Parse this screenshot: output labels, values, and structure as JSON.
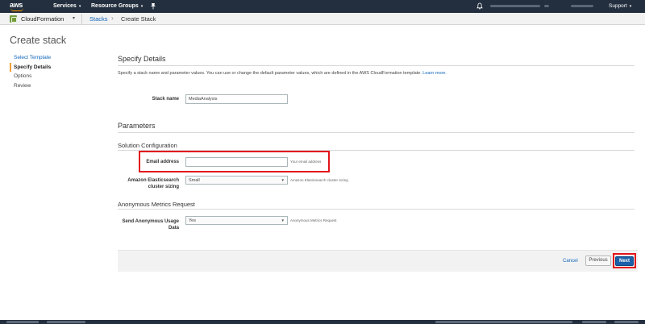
{
  "topnav": {
    "logo_text": "aws",
    "services_label": "Services",
    "resource_groups_label": "Resource Groups",
    "pin_icon": "pin-icon",
    "bell_icon": "bell-icon",
    "support_label": "Support"
  },
  "subnav": {
    "service_label": "CloudFormation",
    "breadcrumb": {
      "stacks_label": "Stacks",
      "separator": "›",
      "current": "Create Stack"
    }
  },
  "page": {
    "title": "Create stack",
    "steps": [
      {
        "label": "Select Template",
        "state": "link"
      },
      {
        "label": "Specify Details",
        "state": "active"
      },
      {
        "label": "Options",
        "state": "normal"
      },
      {
        "label": "Review",
        "state": "normal"
      }
    ]
  },
  "details": {
    "title": "Specify Details",
    "description": "Specify a stack name and parameter values. You can use or change the default parameter values, which are defined in the AWS CloudFormation template.",
    "learn_more": "Learn more.",
    "stack_name_label": "Stack name",
    "stack_name_value": "MediaAnalysis"
  },
  "parameters": {
    "title": "Parameters",
    "solution_config_title": "Solution Configuration",
    "email": {
      "label": "Email address",
      "value": "",
      "hint": "Your email address"
    },
    "es_sizing": {
      "label_line1": "Amazon Elasticsearch",
      "label_line2": "cluster sizing",
      "selected": "Small",
      "hint": "Amazon Elasticsearch cluster sizing"
    },
    "anon_metrics_title": "Anonymous Metrics Request",
    "anon_usage": {
      "label_line1": "Send Anonymous Usage",
      "label_line2": "Data",
      "selected": "Yes",
      "hint": "Anonymous Metrics Request"
    }
  },
  "actions": {
    "cancel_label": "Cancel",
    "previous_label": "Previous",
    "next_label": "Next"
  },
  "colors": {
    "nav_bg": "#232f3e",
    "link": "#1166bb",
    "primary_button": "#1b5fa8",
    "highlight": "#e2141b",
    "active_step_accent": "#f29e38"
  }
}
